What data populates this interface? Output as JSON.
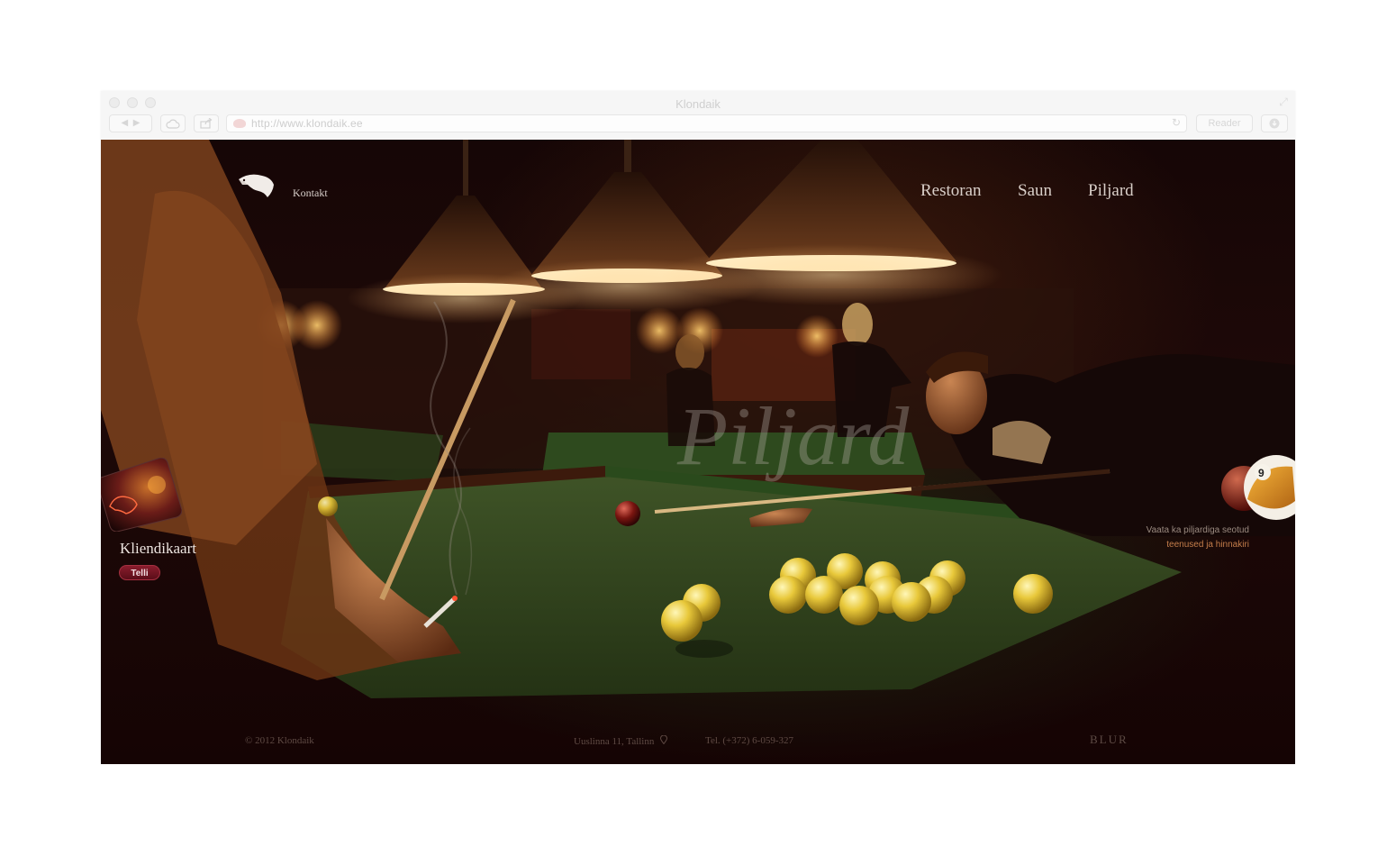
{
  "browser": {
    "title": "Klondaik",
    "url": "http://www.klondaik.ee",
    "reader_label": "Reader"
  },
  "header": {
    "kontakt_label": "Kontakt",
    "nav": [
      "Restoran",
      "Saun",
      "Piljard"
    ]
  },
  "hero": {
    "script_title": "Piljard"
  },
  "card": {
    "title": "Kliendikaart",
    "button_label": "Telli"
  },
  "side": {
    "line1": "Vaata ka piljardiga seotud",
    "line2": "teenused ja hinnakiri"
  },
  "footer": {
    "copyright": "© 2012 Klondaik",
    "address": "Uuslinna 11, Tallinn",
    "phone": "Tel.  (+372) 6-059-327",
    "brand": "BLUR"
  },
  "colors": {
    "page_bg": "#160606",
    "felt": "#3b4d22",
    "accent_red": "#7a1524",
    "ball_yellow": "#e8c83a",
    "side_link": "#c47d4a"
  }
}
